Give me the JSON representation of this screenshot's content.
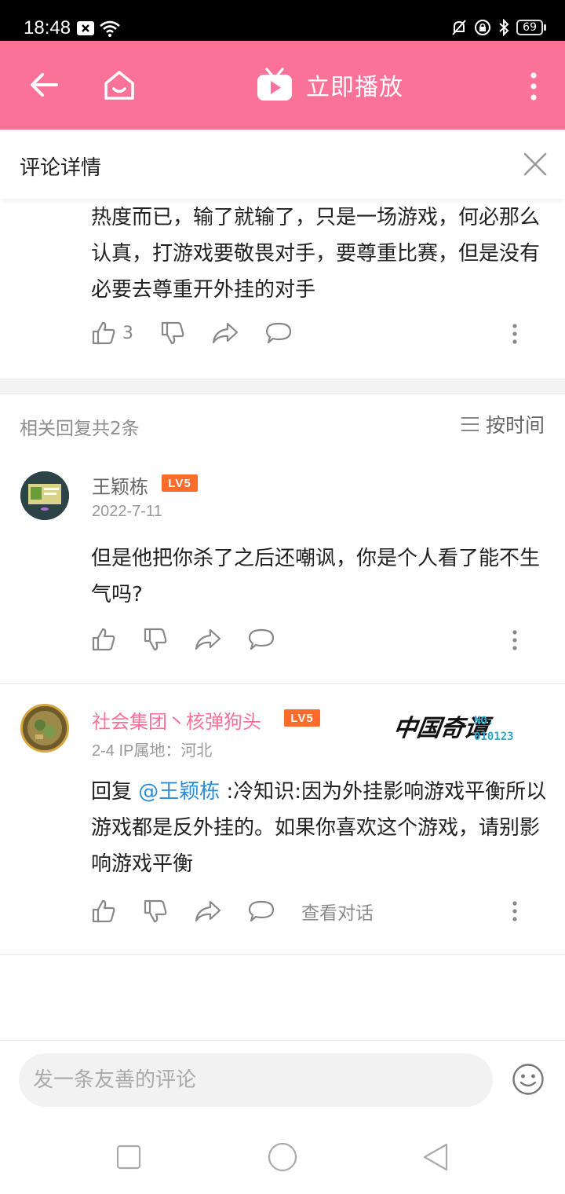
{
  "status_bar": {
    "time": "18:48",
    "battery": "69"
  },
  "appbar": {
    "play_label": "立即播放"
  },
  "panel": {
    "title": "评论详情"
  },
  "main_comment": {
    "text": "热度而已，输了就输了，只是一场游戏，何必那么认真，打游戏要敬畏对手，要尊重比赛，但是没有必要去尊重开外挂的对手",
    "like_count": "3"
  },
  "replies_header": {
    "count_label": "相关回复共2条",
    "sort_label": "按时间"
  },
  "replies": [
    {
      "username": "王颖栋",
      "level": "LV5",
      "meta": "2022-7-11",
      "text": "但是他把你杀了之后还嘲讽，你是个人看了能不生气吗?"
    },
    {
      "username": "社会集团丶核弹狗头",
      "level": "LV5",
      "meta": "2-4  IP属地：河北",
      "reply_prefix": "回复 ",
      "mention": "@王颖栋",
      "text": " :冷知识:因为外挂影响游戏平衡所以游戏都是反外挂的。如果你喜欢这个游戏，请别影响游戏平衡",
      "view_conversation": "查看对话",
      "medal": {
        "script": "中国奇谭",
        "no_label": "NO.",
        "no_value": "010123"
      }
    }
  ],
  "input": {
    "placeholder": "发一条友善的评论"
  },
  "colors": {
    "brand_pink": "#fb7299",
    "level_orange": "#ff6b2b",
    "mention_blue": "#2b8dd8",
    "username_pink": "#fb7299"
  }
}
